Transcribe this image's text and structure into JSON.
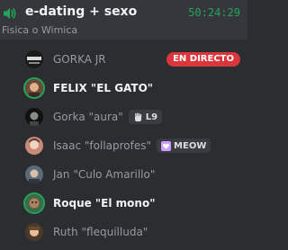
{
  "channel": {
    "name": "e-dating + sexo",
    "timer": "50:24:29",
    "status": "Fisica o Wimica",
    "icon": "speaker-icon",
    "accent_color": "#23a559"
  },
  "users": [
    {
      "name": "GORKA JR",
      "speaking": false,
      "badge": "EN DIRECTO",
      "badge_color": "#da373c",
      "avatar_colors": [
        "#1a1a1a",
        "#d9d9d9"
      ]
    },
    {
      "name": "FELIX \"EL GATO\"",
      "speaking": true,
      "avatar_colors": [
        "#6b4a3a",
        "#e0b08a"
      ]
    },
    {
      "name": "Gorka \"aura\"",
      "speaking": false,
      "tag": {
        "icon": "hand-icon",
        "text": "L9"
      },
      "avatar_colors": [
        "#111111",
        "#8a8a8a"
      ]
    },
    {
      "name": "Isaac \"follaprofes\"",
      "speaking": false,
      "tag": {
        "icon": "heart-icon",
        "text": "MEOW",
        "color": "#c9a0ff"
      },
      "avatar_colors": [
        "#c98a7a",
        "#f2d2c0"
      ]
    },
    {
      "name": "Jan \"Culo Amarillo\"",
      "speaking": false,
      "avatar_colors": [
        "#5a6a7a",
        "#d8c0a8"
      ]
    },
    {
      "name": "Roque \"El mono\"",
      "speaking": true,
      "avatar_colors": [
        "#3d6a4a",
        "#b08060"
      ]
    },
    {
      "name": "Ruth \"flequilluda\"",
      "speaking": false,
      "avatar_colors": [
        "#4a3a2a",
        "#e8c0a0"
      ]
    }
  ]
}
